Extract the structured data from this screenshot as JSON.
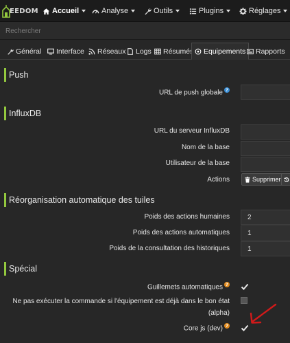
{
  "navbar": {
    "logo_text": "EEDOM",
    "items": [
      {
        "label": "Accueil",
        "icon": "home-icon"
      },
      {
        "label": "Analyse",
        "icon": "dashboard-icon"
      },
      {
        "label": "Outils",
        "icon": "wrench-icon"
      },
      {
        "label": "Plugins",
        "icon": "list-icon"
      },
      {
        "label": "Réglages",
        "icon": "gear-icon"
      }
    ]
  },
  "search": {
    "placeholder": "Rechercher"
  },
  "tabs": [
    {
      "label": "Général",
      "icon": "wrench-icon"
    },
    {
      "label": "Interface",
      "icon": "monitor-icon"
    },
    {
      "label": "Réseaux",
      "icon": "rss-icon"
    },
    {
      "label": "Logs",
      "icon": "file-icon"
    },
    {
      "label": "Résumés",
      "icon": "table-icon"
    },
    {
      "label": "Equipements",
      "icon": "satellite-icon"
    },
    {
      "label": "Rapports",
      "icon": "newspaper-icon"
    }
  ],
  "sections": {
    "push": {
      "title": "Push",
      "url_label": "URL de push globale",
      "url_value": ""
    },
    "influx": {
      "title": "InfluxDB",
      "server_label": "URL du serveur InfluxDB",
      "server_value": "",
      "db_label": "Nom de la base",
      "db_value": "",
      "user_label": "Utilisateur de la base",
      "user_value": "",
      "actions_label": "Actions",
      "delete_label": "Supprimer"
    },
    "tiles": {
      "title": "Réorganisation automatique des tuiles",
      "human_label": "Poids des actions humaines",
      "human_value": "2",
      "auto_label": "Poids des actions automatiques",
      "auto_value": "1",
      "history_label": "Poids de la consultation des historiques",
      "history_value": "1"
    },
    "special": {
      "title": "Spécial",
      "quotes_label": "Guillemets automatiques",
      "quotes_checked": true,
      "noexec_label_line1": "Ne pas exécuter la commande si l'équipement est déjà dans le bon état",
      "noexec_label_line2": "(alpha)",
      "noexec_checked": false,
      "corejs_label": "Core js (dev)",
      "corejs_checked": true
    }
  },
  "colors": {
    "accent": "#93c83e",
    "help_blue": "#3b8fd6",
    "help_orange": "#e08a1e",
    "arrow_red": "#d11a1a"
  }
}
